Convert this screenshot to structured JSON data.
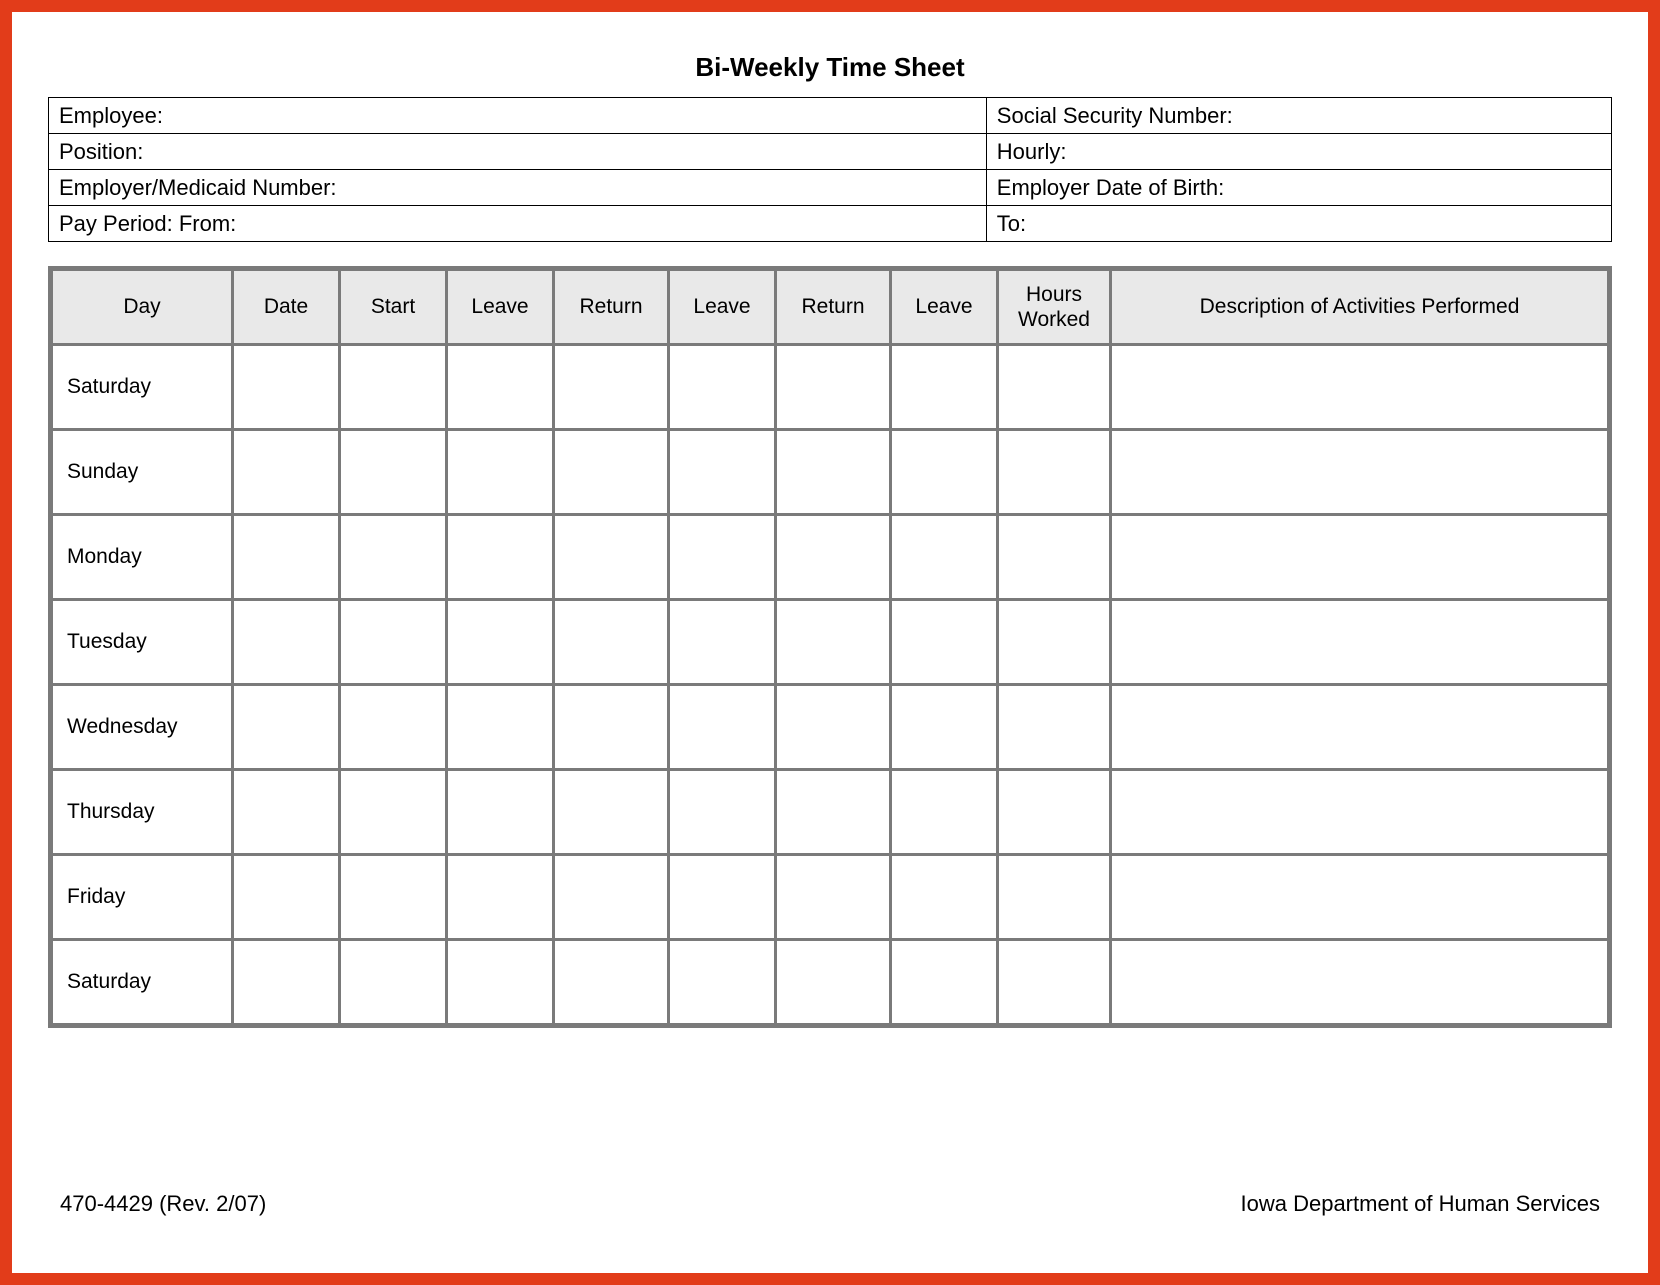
{
  "title": "Bi-Weekly Time Sheet",
  "info": {
    "employee_label": "Employee:",
    "ssn_label": "Social Security Number:",
    "position_label": "Position:",
    "hourly_label": "Hourly:",
    "employer_medicaid_label": "Employer/Medicaid Number:",
    "employer_dob_label": "Employer Date of Birth:",
    "pay_period_from_label": "Pay Period:  From:",
    "pay_period_to_label": "To:"
  },
  "grid": {
    "headers": {
      "day": "Day",
      "date": "Date",
      "start": "Start",
      "leave1": "Leave",
      "return1": "Return",
      "leave2": "Leave",
      "return2": "Return",
      "leave3": "Leave",
      "hours_worked": "Hours Worked",
      "description": "Description of Activities Performed"
    },
    "rows": [
      {
        "day": "Saturday"
      },
      {
        "day": "Sunday"
      },
      {
        "day": "Monday"
      },
      {
        "day": "Tuesday"
      },
      {
        "day": "Wednesday"
      },
      {
        "day": "Thursday"
      },
      {
        "day": "Friday"
      },
      {
        "day": "Saturday"
      }
    ]
  },
  "footer": {
    "form_number": "470-4429  (Rev. 2/07)",
    "agency": "Iowa Department of Human Services"
  }
}
